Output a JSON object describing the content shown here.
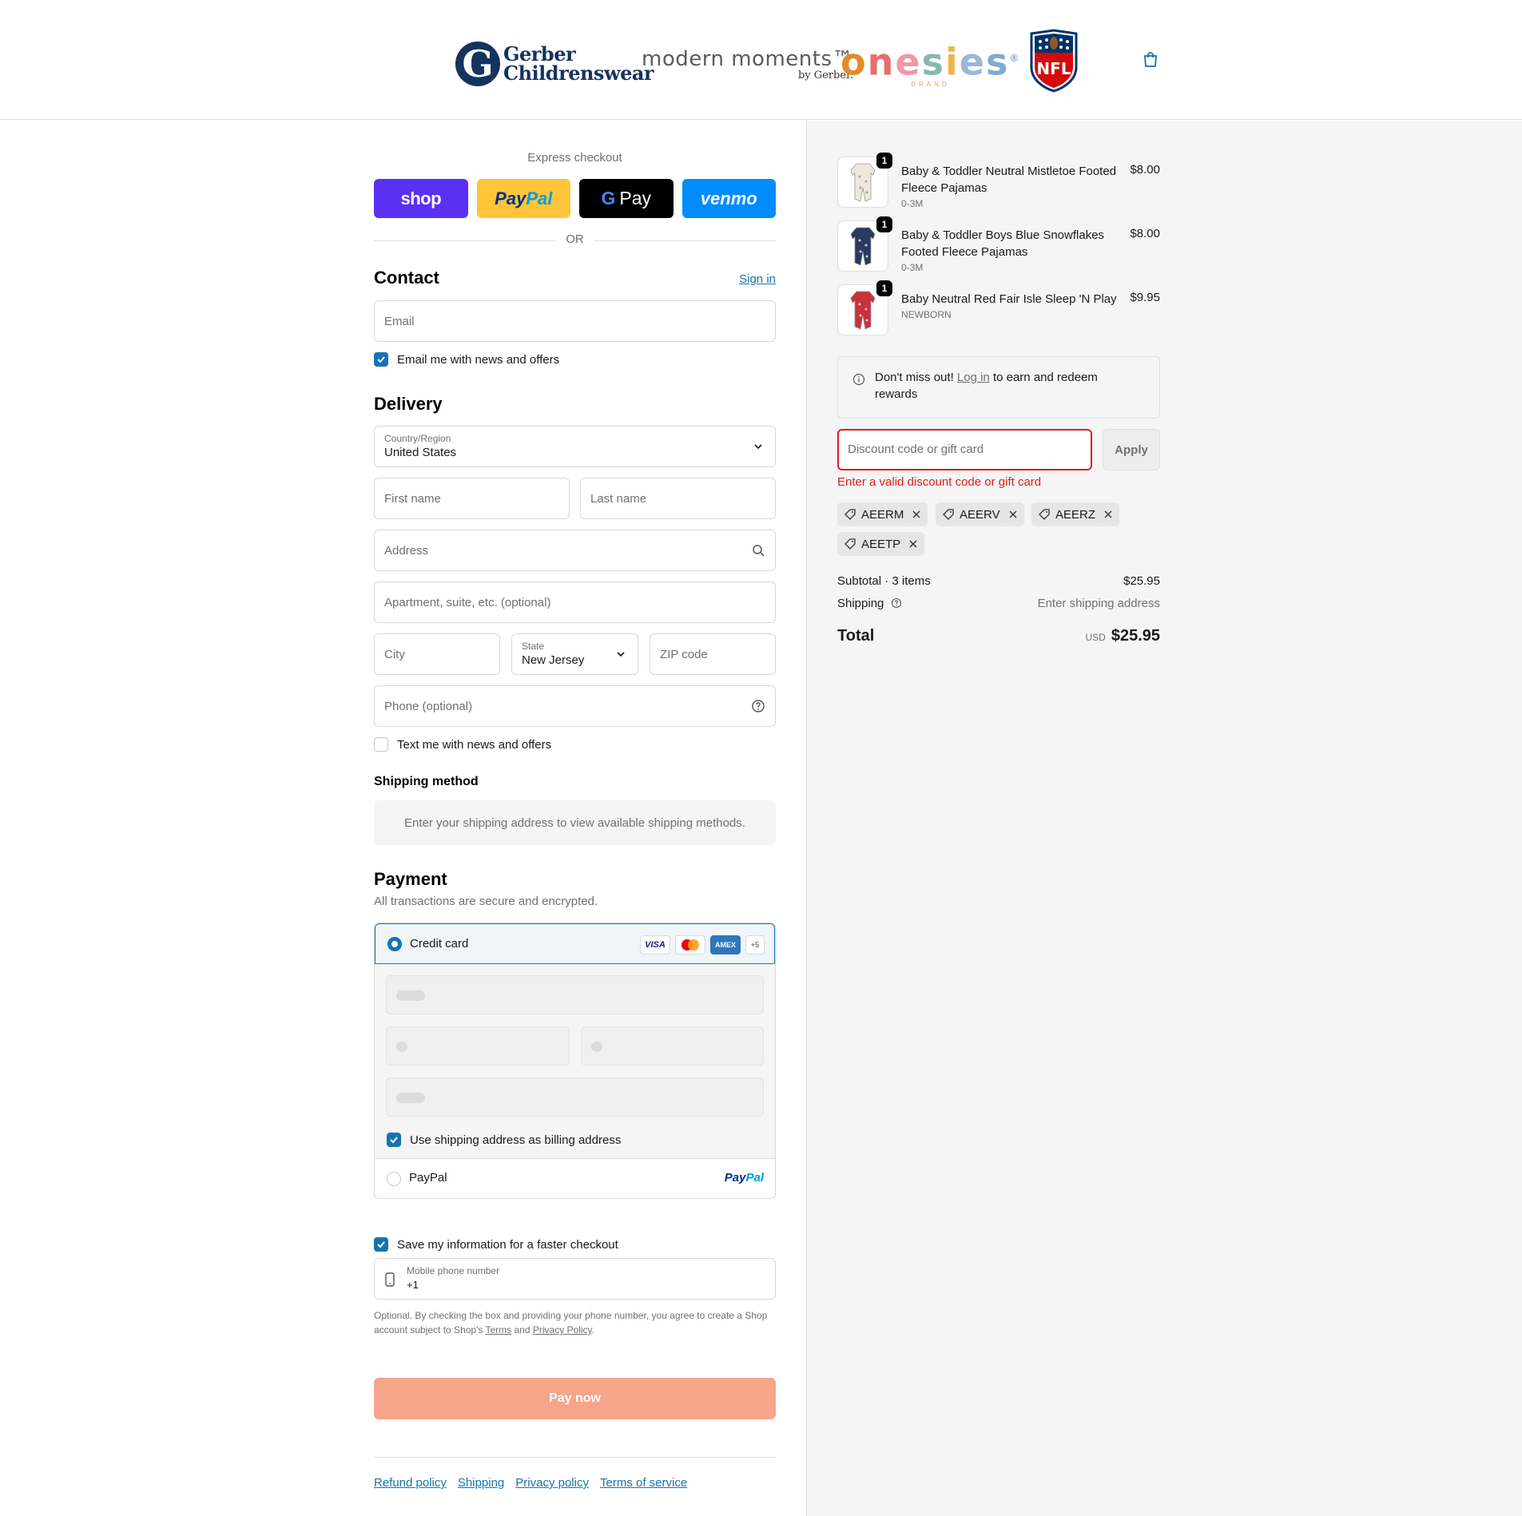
{
  "header": {
    "brands": {
      "gerber": {
        "mark": "G",
        "line1": "Gerber",
        "line2": "Childrenswear"
      },
      "modern_moments": {
        "main": "modern moments™",
        "sub": "by Gerber."
      },
      "onesies": {
        "letters": [
          "o",
          "n",
          "e",
          "s",
          "i",
          "e",
          "s"
        ],
        "sub": "BRAND",
        "tm": "®"
      },
      "nfl": {
        "text": "NFL"
      }
    },
    "cart_icon": "shopping-bag-icon"
  },
  "express": {
    "title": "Express checkout",
    "shop_label": "shop",
    "paypal_label_1": "Pay",
    "paypal_label_2": "Pal",
    "gpay_g": "G",
    "gpay_label": "Pay",
    "venmo_label": "venmo",
    "or_label": "OR"
  },
  "contact": {
    "title": "Contact",
    "sign_in": "Sign in",
    "email_placeholder": "Email",
    "news_label": "Email me with news and offers",
    "news_checked": true
  },
  "delivery": {
    "title": "Delivery",
    "country_label": "Country/Region",
    "country_value": "United States",
    "first_name": "First name",
    "last_name": "Last name",
    "address": "Address",
    "apartment": "Apartment, suite, etc. (optional)",
    "city": "City",
    "state_label": "State",
    "state_value": "New Jersey",
    "zip": "ZIP code",
    "phone": "Phone (optional)",
    "text_label": "Text me with news and offers",
    "text_checked": false
  },
  "shipping_method": {
    "title": "Shipping method",
    "message": "Enter your shipping address to view available shipping methods."
  },
  "payment": {
    "title": "Payment",
    "subtitle": "All transactions are secure and encrypted.",
    "credit_card_label": "Credit card",
    "cards": {
      "visa": "VISA",
      "amex": "AMEX",
      "more": "+5"
    },
    "billing_label": "Use shipping address as billing address",
    "billing_checked": true,
    "paypal_label": "PayPal",
    "paypal_logo_1": "Pay",
    "paypal_logo_2": "Pal"
  },
  "save_info": {
    "label": "Save my information for a faster checkout",
    "checked": true,
    "mobile_label": "Mobile phone number",
    "mobile_value": "+1",
    "fine_1": "Optional. By checking the box and providing your phone number, you agree to create a Shop account subject to Shop's ",
    "terms": "Terms",
    "and": " and ",
    "privacy": "Privacy Policy",
    "period": "."
  },
  "pay_now": "Pay now",
  "footer_links": [
    "Refund policy",
    "Shipping",
    "Privacy policy",
    "Terms of service"
  ],
  "order": {
    "items": [
      {
        "name": "Baby & Toddler Neutral Mistletoe Footed Fleece Pajamas",
        "variant": "0-3M",
        "price": "$8.00",
        "qty": "1",
        "color": "#ece8dc",
        "pattern": "#b9a58a"
      },
      {
        "name": "Baby & Toddler Boys Blue Snowflakes Footed Fleece Pajamas",
        "variant": "0-3M",
        "price": "$8.00",
        "qty": "1",
        "color": "#2a3a5e",
        "pattern": "#c9d2e3"
      },
      {
        "name": "Baby Neutral Red Fair Isle Sleep 'N Play",
        "variant": "NEWBORN",
        "price": "$9.95",
        "qty": "1",
        "color": "#c8323c",
        "pattern": "#f2d0d0"
      }
    ],
    "rewards_1": "Don't miss out! ",
    "rewards_link": "Log in",
    "rewards_2": " to earn and redeem rewards",
    "discount_placeholder": "Discount code or gift card",
    "apply_label": "Apply",
    "discount_error": "Enter a valid discount code or gift card",
    "codes": [
      "AEERM",
      "AEERV",
      "AEERZ",
      "AEETP"
    ],
    "subtotal_label": "Subtotal · 3 items",
    "subtotal_value": "$25.95",
    "shipping_label": "Shipping",
    "shipping_value": "Enter shipping address",
    "total_label": "Total",
    "currency": "USD",
    "total_value": "$25.95"
  },
  "colors": {
    "accent": "#1773b0",
    "error": "#dd1d1d",
    "pay_button": "#f6a58a",
    "shop": "#5a31f4"
  }
}
